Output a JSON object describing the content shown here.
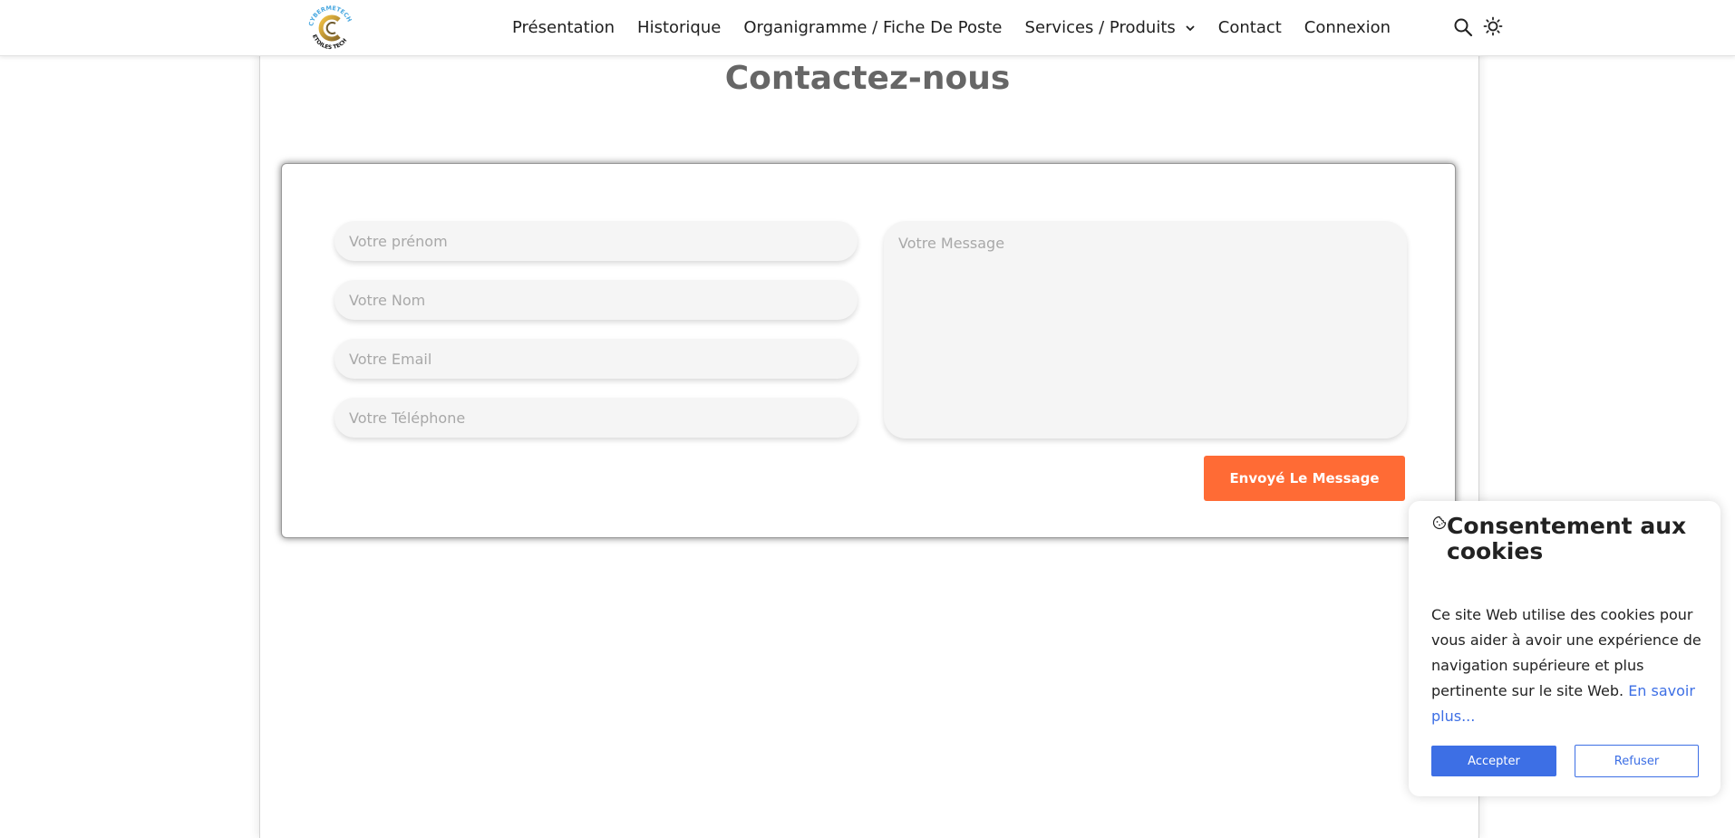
{
  "header": {
    "logo_text_top": "CYBERMETECH",
    "logo_text_bottom": "ETOILES TECH",
    "nav": [
      {
        "label": "Présentation"
      },
      {
        "label": "Historique"
      },
      {
        "label": "Organigramme / Fiche De Poste"
      },
      {
        "label": "Services / Produits"
      },
      {
        "label": "Contact"
      },
      {
        "label": "Connexion"
      }
    ],
    "icons": [
      "search-icon",
      "theme-toggle-icon"
    ]
  },
  "main": {
    "title": "Contactez-nous",
    "form": {
      "firstname_placeholder": "Votre prénom",
      "lastname_placeholder": "Votre Nom",
      "email_placeholder": "Votre Email",
      "phone_placeholder": "Votre Téléphone",
      "message_placeholder": "Votre Message",
      "submit_label": "Envoyé Le Message"
    }
  },
  "cookie": {
    "title": "Consentement aux cookies",
    "text": "Ce site Web utilise des cookies pour vous aider à avoir une expérience de navigation supérieure et plus pertinente sur le site Web.",
    "link": "En savoir plus...",
    "accept_label": "Accepter",
    "refuse_label": "Refuser"
  },
  "colors": {
    "accent": "#ff6b35",
    "primary": "#3d6fe5"
  }
}
